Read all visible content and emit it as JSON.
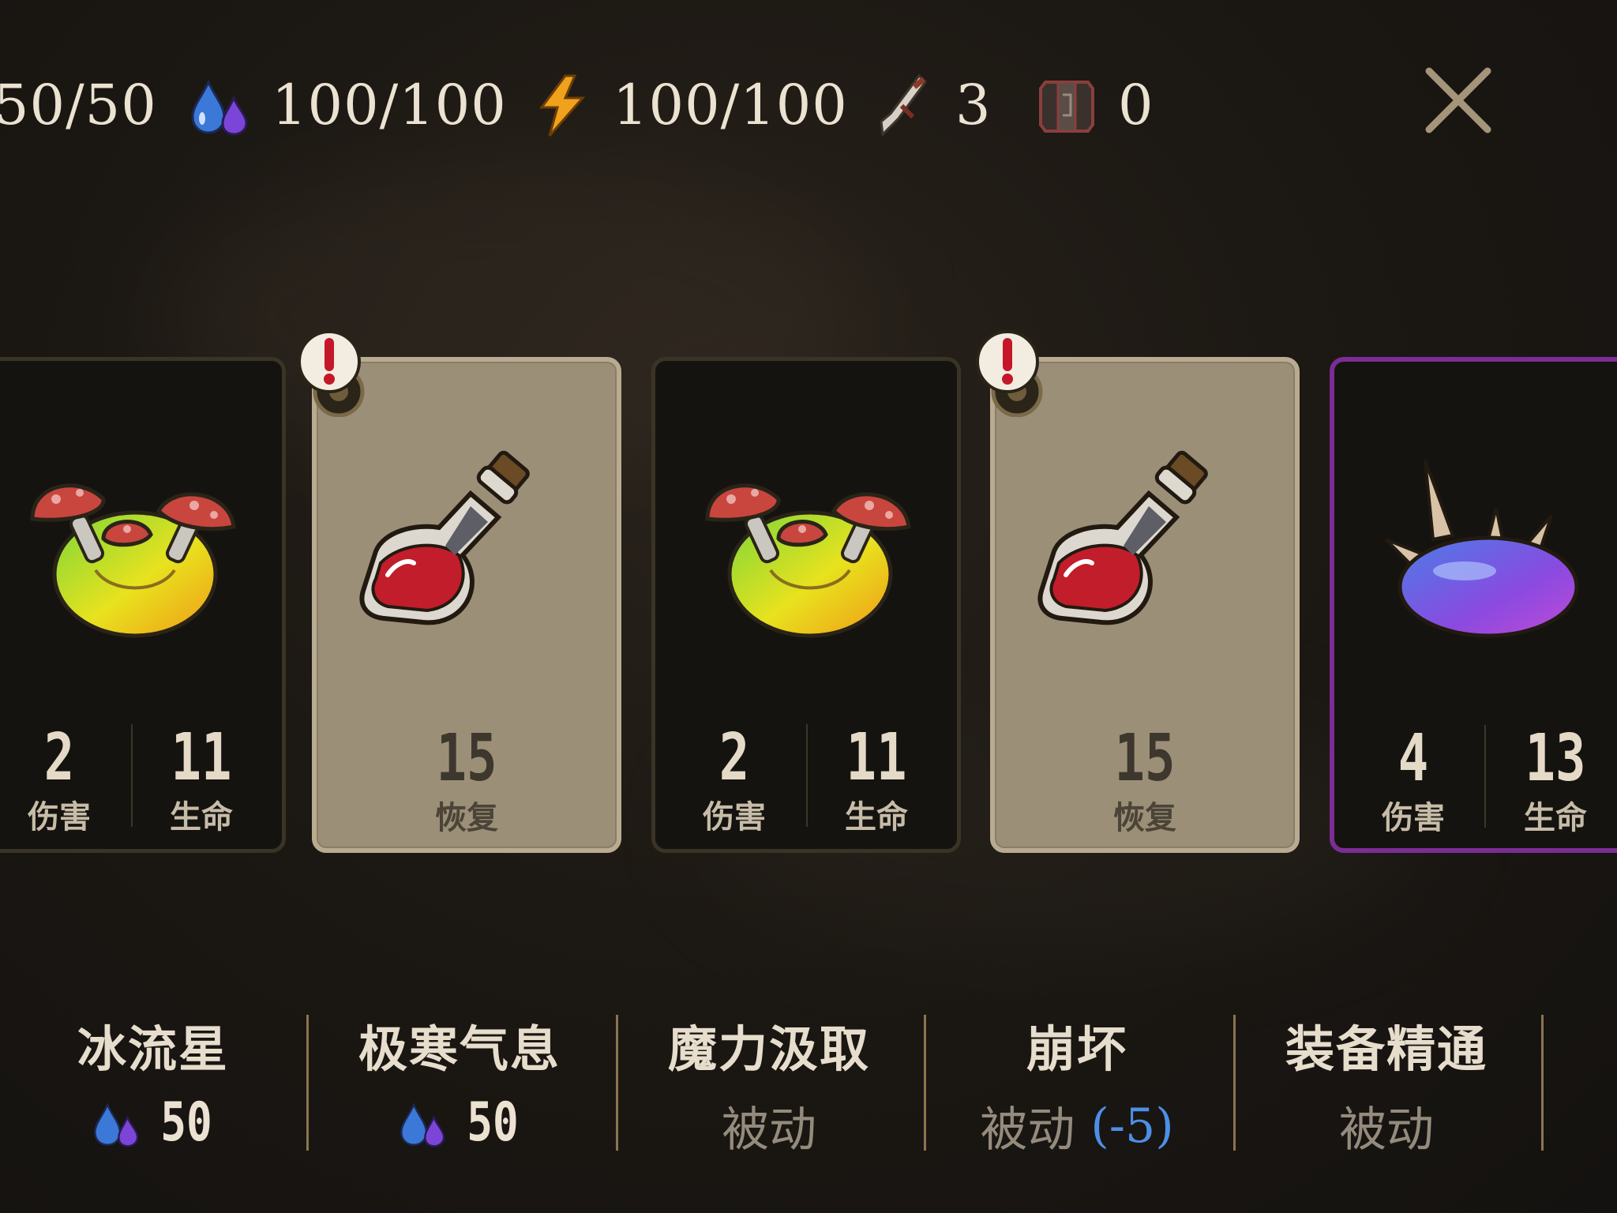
{
  "stats": {
    "hp": "50/50",
    "mana": "100/100",
    "energy": "100/100",
    "attack": "3",
    "armor": "0"
  },
  "cards": [
    {
      "style": "dark",
      "art": "mushroom-slime",
      "damage": "2",
      "damage_label": "伤害",
      "life": "11",
      "life_label": "生命"
    },
    {
      "style": "light",
      "art": "red-potion",
      "value": "15",
      "value_label": "恢复",
      "alert": true
    },
    {
      "style": "dark",
      "art": "mushroom-slime",
      "damage": "2",
      "damage_label": "伤害",
      "life": "11",
      "life_label": "生命"
    },
    {
      "style": "light",
      "art": "red-potion",
      "value": "15",
      "value_label": "恢复",
      "alert": true
    },
    {
      "style": "purple",
      "art": "spiked-slime",
      "damage": "4",
      "damage_label": "伤害",
      "life": "13",
      "life_label": "生命"
    }
  ],
  "skills": [
    {
      "name": "冰流星",
      "cost": "50"
    },
    {
      "name": "极寒气息",
      "cost": "50"
    },
    {
      "name": "魔力汲取",
      "passive": "被动"
    },
    {
      "name": "崩坏",
      "passive": "被动",
      "modifier": "(-5)"
    },
    {
      "name": "装备精通",
      "passive": "被动"
    }
  ],
  "colors": {
    "accent_purple": "#7b2d96",
    "mod_blue": "#4d8fe6",
    "divider": "#8a7550"
  }
}
